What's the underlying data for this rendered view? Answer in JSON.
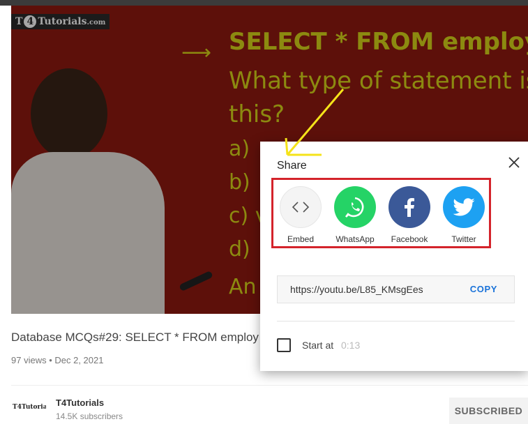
{
  "video": {
    "watermark_prefix": "T",
    "watermark_num": "4",
    "watermark_suffix": "Tutorials",
    "watermark_tld": ".com",
    "slide_sql": "SELECT * FROM employee",
    "slide_q1": "What type of statement is",
    "slide_q2": "this?",
    "opt_a": "a)",
    "opt_b": "b)",
    "opt_c": "c) v",
    "opt_d": "d)",
    "opt_ans": "An"
  },
  "video_info": {
    "title": "Database MCQs#29: SELECT * FROM employ",
    "views": "97 views",
    "date": "Dec 2, 2021"
  },
  "channel": {
    "logo_text": "T4Tutorials",
    "name": "T4Tutorials",
    "subscribers": "14.5K subscribers",
    "subscribe_label": "SUBSCRIBED"
  },
  "share_dialog": {
    "title": "Share",
    "options": [
      {
        "label": "Embed",
        "icon": "embed-icon"
      },
      {
        "label": "WhatsApp",
        "icon": "whatsapp-icon"
      },
      {
        "label": "Facebook",
        "icon": "facebook-icon"
      },
      {
        "label": "Twitter",
        "icon": "twitter-icon"
      }
    ],
    "url": "https://youtu.be/L85_KMsgEes",
    "copy_label": "COPY",
    "start_at_label": "Start at",
    "start_at_time": "0:13"
  },
  "colors": {
    "highlight_box": "#d4232b",
    "annotation_arrow": "#f5e31a",
    "whatsapp": "#25d366",
    "facebook": "#3b5998",
    "twitter": "#1da1f2",
    "copy": "#1a73d9"
  }
}
